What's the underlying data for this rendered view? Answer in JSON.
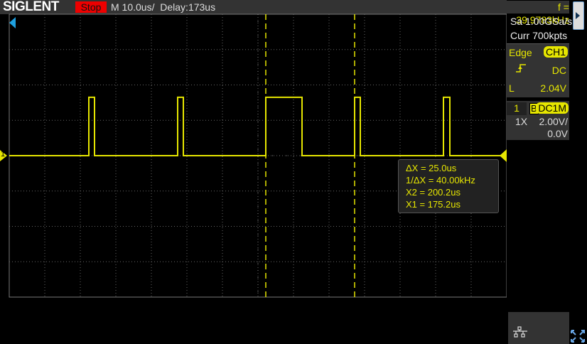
{
  "header": {
    "brand": "SIGLENT",
    "run_state": "Stop",
    "timebase": "M 10.0us/",
    "delay": "Delay:173us",
    "frequency": "f = 39.9783kHz"
  },
  "acquisition": {
    "sample_rate": "Sa 1.00GSa/s",
    "memory": "Curr 700kpts"
  },
  "trigger": {
    "type": "Edge",
    "source": "CH1",
    "slope_icon": "rising-edge-icon",
    "coupling": "DC",
    "level_label": "L",
    "level": "2.04V"
  },
  "channel": {
    "number": "1",
    "bw_limit": "B",
    "coupling": "DC1M",
    "probe": "1X",
    "scale": "2.00V/",
    "offset": "0.0V",
    "marker": "1"
  },
  "cursors": {
    "delta_x": "ΔX = 25.0us",
    "inv_delta_x": "1/ΔX = 40.00kHz",
    "x2": "X2 = 200.2us",
    "x1": "X1 = 175.2us"
  },
  "colors": {
    "trace": "#e6e600",
    "grid": "#666666",
    "stop": "#e00000",
    "trigger_marker": "#1ea0e0"
  },
  "chart_data": {
    "type": "line",
    "x_units": "us from screen left",
    "y_units": "V",
    "xlim": [
      0,
      140
    ],
    "ylim": [
      -8,
      8
    ],
    "x_per_div": 10,
    "y_per_div": 2,
    "pulses": [
      {
        "start": 22.4,
        "end": 24.0
      },
      {
        "start": 47.4,
        "end": 49.0
      },
      {
        "start": 72.2,
        "end": 82.4
      },
      {
        "start": 97.2,
        "end": 98.8
      },
      {
        "start": 122.2,
        "end": 124.0
      }
    ],
    "low": 0,
    "high": 3.3,
    "cursor_x": [
      72.2,
      97.2
    ]
  }
}
